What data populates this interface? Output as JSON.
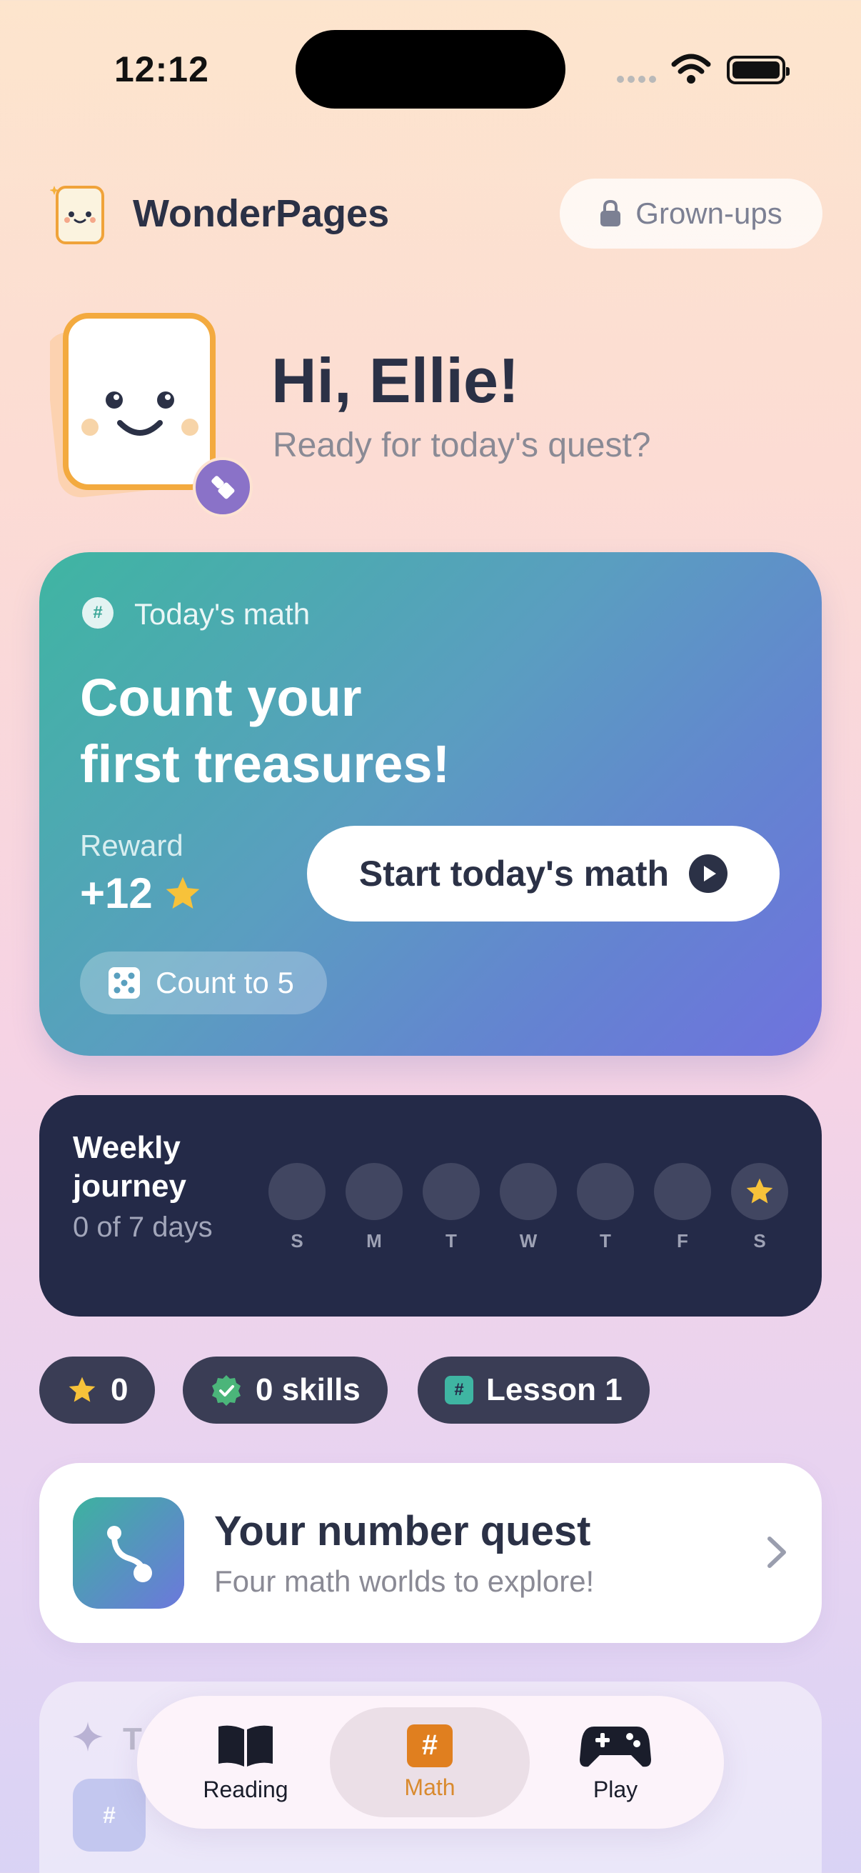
{
  "status_bar": {
    "time": "12:12"
  },
  "header": {
    "app_title": "WonderPages",
    "grownups_label": "Grown-ups"
  },
  "greeting": {
    "title": "Hi, Ellie!",
    "subtitle": "Ready for today's quest?"
  },
  "math_card": {
    "kicker": "Today's math",
    "kicker_icon": "#",
    "title_line1": "Count your",
    "title_line2": "first treasures!",
    "reward_label": "Reward",
    "reward_value": "+12",
    "start_label": "Start today's math",
    "chip_label": "Count to 5",
    "colors": {
      "start": "#3fb5a2",
      "end": "#6f72de"
    }
  },
  "journey": {
    "title": "Weekly journey",
    "progress": "0 of 7 days",
    "days_completed": 0,
    "days": [
      {
        "label": "S",
        "star": false
      },
      {
        "label": "M",
        "star": false
      },
      {
        "label": "T",
        "star": false
      },
      {
        "label": "W",
        "star": false
      },
      {
        "label": "T",
        "star": false
      },
      {
        "label": "F",
        "star": false
      },
      {
        "label": "S",
        "star": true
      }
    ]
  },
  "stats": {
    "stars": "0",
    "skills": "0 skills",
    "lesson_icon": "#",
    "lesson": "Lesson 1"
  },
  "quest": {
    "title": "Your number quest",
    "subtitle": "Four math worlds to explore!"
  },
  "next_card": {
    "title_fragment": "T",
    "icon": "#"
  },
  "tabs": [
    {
      "label": "Reading",
      "icon": "book-icon",
      "active": false
    },
    {
      "label": "Math",
      "icon": "hash-icon",
      "active": true,
      "icon_glyph": "#"
    },
    {
      "label": "Play",
      "icon": "gamepad-icon",
      "active": false
    }
  ],
  "colors": {
    "accent_orange": "#f0a33a",
    "navy": "#242a48",
    "star_yellow": "#f7c23a",
    "skill_green": "#4bb57a"
  }
}
